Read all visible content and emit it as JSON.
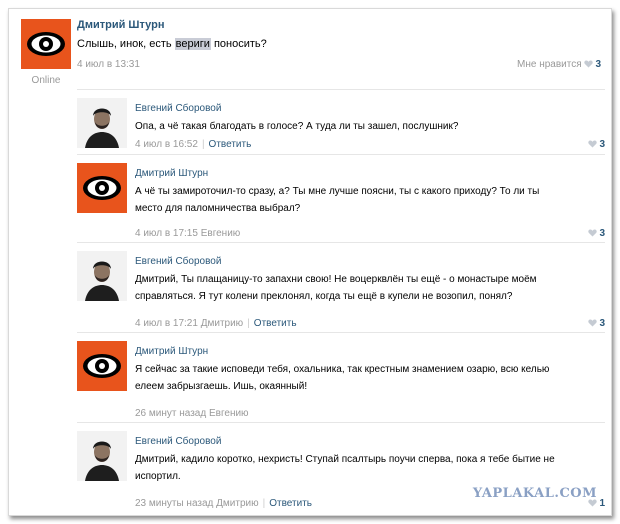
{
  "post": {
    "author": "Дмитрий Штурн",
    "text_before": "Слышь, инок, есть ",
    "text_highlight": "вериги",
    "text_after": " поносить?",
    "date": "4 июл в 13:31",
    "status": "Online",
    "like_label": "Мне нравится",
    "like_count": "3"
  },
  "comments": [
    {
      "author": "Евгений Сборовой",
      "text": "Опа, а чё такая благодать в голосе? А туда ли ты зашел, послушник?",
      "date": "4 июл в 16:52",
      "reply": "Ответить",
      "likes": "3"
    },
    {
      "author": "Дмитрий Штурн",
      "text_line1": "А чё ты замироточил-то сразу, а? Ты мне лучше поясни, ты с какого приходу? То ли ты",
      "text_line2": "место для паломничества выбрал?",
      "date": "4 июл в 17:15 Евгению",
      "likes": "3"
    },
    {
      "author": "Евгений Сборовой",
      "text_line1": "Дмитрий, Ты плащаницу-то запахни свою! Не воцерквлён ты ещё - о монастыре моём",
      "text_line2": "справляться. Я тут колени преклонял, когда ты ещё в купели не возопил, понял?",
      "date": "4 июл в 17:21 Дмитрию",
      "reply": "Ответить",
      "likes": "3"
    },
    {
      "author": "Дмитрий Штурн",
      "text_line1": "Я сейчас за такие исповеди тебя, охальника, так крестным знамением озарю, всю келью",
      "text_line2": "елеем забрызгаешь. Ишь, окаянный!",
      "date": "26 минут назад Евгению"
    },
    {
      "author": "Евгений Сборовой",
      "text_line1": "Дмитрий, кадило коротко, нехристь! Ступай псалтырь поучи сперва, пока я тебе бытие не",
      "text_line2": "испортил.",
      "date": "23 минуты назад Дмитрию",
      "reply": "Ответить",
      "likes": "1"
    }
  ],
  "watermark": "YAPLAKAL.COM",
  "colors": {
    "link": "#2b587a",
    "meta": "#999999",
    "eye_orange": "#e8541c"
  }
}
